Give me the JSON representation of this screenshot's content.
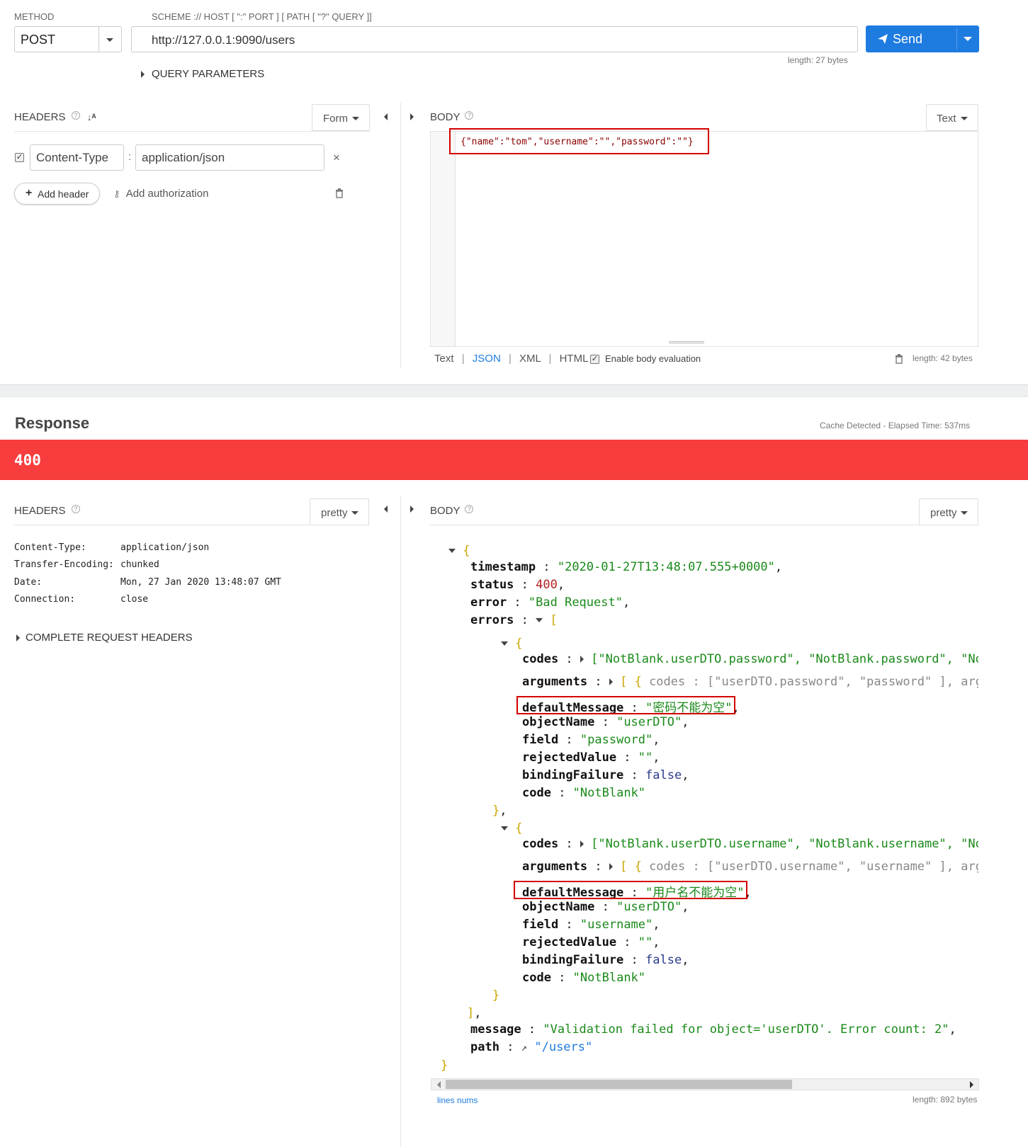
{
  "request": {
    "method_label": "METHOD",
    "method": "POST",
    "url_label": "SCHEME :// HOST [ \":\" PORT ] [ PATH [ \"?\" QUERY ]]",
    "url": "http://127.0.0.1:9090/users",
    "url_length": "length: 27 bytes",
    "send_label": "Send",
    "query_parameters": "QUERY PARAMETERS",
    "headers_label": "HEADERS",
    "headers_mode": "Form",
    "header_rows": [
      {
        "name": "Content-Type",
        "sep": ":",
        "value": "application/json"
      }
    ],
    "add_header": "Add header",
    "add_authorization": "Add authorization",
    "body_label": "BODY",
    "body_mode": "Text",
    "body_text": "{\"name\":\"tom\",\"username\":\"\",\"password\":\"\"}",
    "body_formats": [
      "Text",
      "JSON",
      "XML",
      "HTML"
    ],
    "body_format_active": "JSON",
    "enable_body_evaluation": "Enable body evaluation",
    "body_length": "length: 42 bytes"
  },
  "response": {
    "title": "Response",
    "timing": "Cache Detected - Elapsed Time: 537ms",
    "status_code": "400",
    "status_color": "#f73d3d",
    "headers_label": "HEADERS",
    "headers_mode": "pretty",
    "body_label": "BODY",
    "body_mode": "pretty",
    "headers": [
      {
        "name": "Content-Type:",
        "value": "application/json"
      },
      {
        "name": "Transfer-Encoding:",
        "value": "chunked"
      },
      {
        "name": "Date:",
        "value": "Mon, 27 Jan 2020 13:48:07 GMT"
      },
      {
        "name": "Connection:",
        "value": "close"
      }
    ],
    "complete_request_headers": "COMPLETE REQUEST HEADERS",
    "json": {
      "timestamp_key": "timestamp",
      "timestamp": "\"2020-01-27T13:48:07.555+0000\"",
      "status_key": "status",
      "status": "400",
      "error_key": "error",
      "error": "\"Bad Request\"",
      "errors_key": "errors",
      "errors": [
        {
          "codes": "[\"NotBlank.userDTO.password\", \"NotBlank.password\", \"NotBlan",
          "arguments_open": "[ {",
          "arguments_codes_key": "codes",
          "arguments_codes": "[\"userDTO.password\", \"password\" ],",
          "arguments_more": "arguments",
          "defaultMessage": "\"密码不能为空\"",
          "objectName": "\"userDTO\"",
          "field": "\"password\"",
          "rejectedValue": "\"\"",
          "bindingFailure": "false",
          "code": "\"NotBlank\""
        },
        {
          "codes": "[\"NotBlank.userDTO.username\", \"NotBlank.username\", \"NotBlan",
          "arguments_open": "[ {",
          "arguments_codes_key": "codes",
          "arguments_codes": "[\"userDTO.username\", \"username\" ],",
          "arguments_more": "arguments",
          "defaultMessage": "\"用户名不能为空\"",
          "objectName": "\"userDTO\"",
          "field": "\"username\"",
          "rejectedValue": "\"\"",
          "bindingFailure": "false",
          "code": "\"NotBlank\""
        }
      ],
      "message_key": "message",
      "message": "\"Validation failed for object='userDTO'. Error count: 2\"",
      "path_key": "path",
      "path": "\"/users\""
    },
    "keys": {
      "codes": "codes",
      "arguments": "arguments",
      "defaultMessage": "defaultMessage",
      "objectName": "objectName",
      "field": "field",
      "rejectedValue": "rejectedValue",
      "bindingFailure": "bindingFailure",
      "code": "code"
    },
    "lines_nums": "lines nums",
    "body_length": "length: 892 bytes"
  },
  "colors": {
    "accent": "#1e7be0",
    "error": "#f73d3d",
    "highlight": "#d40000"
  }
}
